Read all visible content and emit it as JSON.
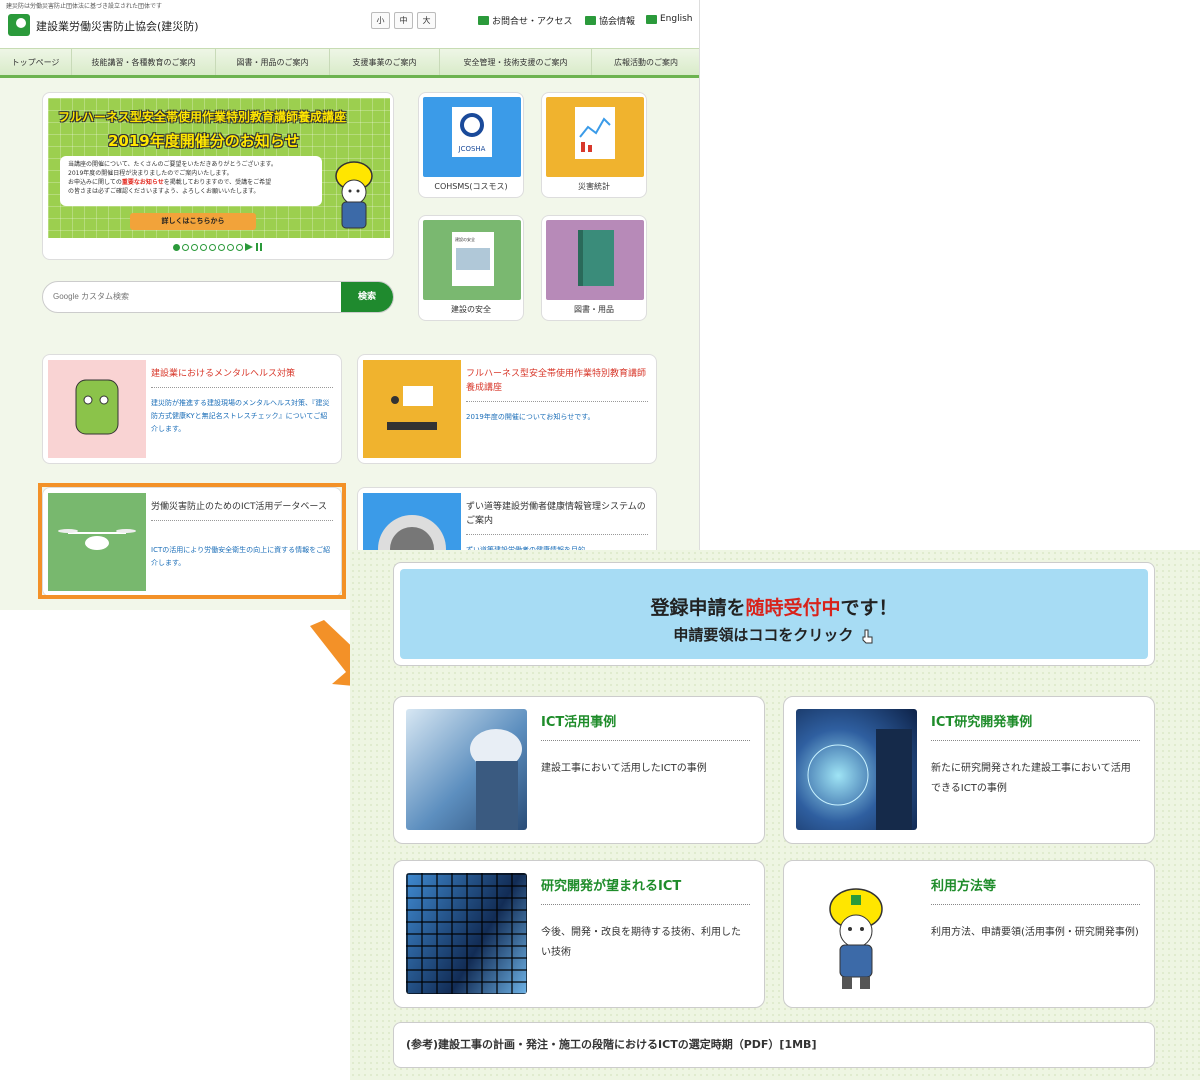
{
  "header": {
    "tagline": "建災防は労働災害防止団体法に基づき設立された団体です",
    "site_name": "建設業労働災害防止協会(建災防)",
    "font_sizes": [
      "小",
      "中",
      "大"
    ],
    "links": [
      {
        "label": "お問合せ・アクセス",
        "icon": "mail-icon"
      },
      {
        "label": "協会情報",
        "icon": "building-icon"
      },
      {
        "label": "English",
        "icon": "english-a-icon"
      }
    ]
  },
  "nav": [
    {
      "label": "トップページ"
    },
    {
      "label": "技能講習・各種教育のご案内"
    },
    {
      "label": "図書・用品のご案内"
    },
    {
      "label": "支援事業のご案内"
    },
    {
      "label": "安全管理・技術支援のご案内"
    },
    {
      "label": "広報活動のご案内"
    }
  ],
  "hero": {
    "line1": "フルハーネス型安全帯使用作業特別教育講師養成講座",
    "line2": "2019年度開催分のお知らせ",
    "body": [
      "当講座の開催について、たくさんのご要望をいただきありがとうございます。",
      "2019年度の開催日程が決まりましたのでご案内いたします。",
      "お申込みに関しての重要なお知らせを掲載しておりますので、受講をご希望",
      "の皆さまは必ずご確認くださいますよう、よろしくお願いいたします。"
    ],
    "body_highlight": "重要なお知らせ",
    "button": "詳しくはこちらから",
    "slide_count": 8,
    "active_slide": 1
  },
  "search": {
    "placeholder": "Google カスタム検索",
    "button": "検索"
  },
  "tiles": [
    {
      "label": "COHSMS(コスモス)",
      "icon": "cohsms-logo-icon",
      "color": "#3b9be8",
      "sublabel": "JCOSHA"
    },
    {
      "label": "災害統計",
      "icon": "chart-document-icon",
      "color": "#f0b32e"
    },
    {
      "label": "建設の安全",
      "icon": "magazine-icon",
      "color": "#7ab870",
      "sublabel": "建設の安全"
    },
    {
      "label": "図書・用品",
      "icon": "book-icon",
      "color": "#b78ab8"
    }
  ],
  "cards": [
    {
      "title": "建設業におけるメンタルヘルス対策",
      "desc": "建災防が推進する建設現場のメンタルヘルス対策、『建災防方式健康KYと無記名ストレスチェック』についてご紹介します。",
      "title_color": "#d8382b",
      "img": "mascot-icon",
      "img_color": "#f9d3d3"
    },
    {
      "title": "フルハーネス型安全帯使用作業特別教育講師養成講座",
      "desc": "2019年度の開催についてお知らせです。",
      "title_color": "#d8382b",
      "img": "lecture-icon",
      "img_color": "#f0b32e"
    },
    {
      "title": "労働災害防止のためのICT活用データベース",
      "desc": "ICTの活用により労働安全衛生の向上に資する情報をご紹介します。",
      "title_color": "#333333",
      "img": "drone-icon",
      "img_color": "#78b86e"
    },
    {
      "title": "ずい道等建設労働者健康情報管理システムのご案内",
      "desc": "ずい道等建設労働者の健康情報を目的",
      "title_color": "#333333",
      "img": "tunnel-icon",
      "img_color": "#3b9be8"
    }
  ],
  "ict": {
    "banner": {
      "part1": "登録申請を",
      "highlight": "随時受付中",
      "part2": "です！",
      "line2": "申請要領はココをクリック"
    },
    "cards": [
      {
        "title": "ICT活用事例",
        "desc": "建設工事において活用したICTの事例",
        "img": "ict-worker-photo"
      },
      {
        "title": "ICT研究開発事例",
        "desc": "新たに研究開発された建設工事において活用できるICTの事例",
        "img": "ict-research-photo"
      },
      {
        "title": "研究開発が望まれるICT",
        "desc": "今後、開発・改良を期待する技術、利用したい技術",
        "img": "monitor-wall-photo"
      },
      {
        "title": "利用方法等",
        "desc": "利用方法、申請要領(活用事例・研究開発事例)",
        "img": "mascot-helmet-icon"
      }
    ],
    "reference": "(参考)建設工事の計画・発注・施工の段階におけるICTの選定時期（PDF）[1MB]"
  },
  "colors": {
    "brand_green": "#2b9a3b",
    "highlight_orange": "#f39128",
    "ict_green": "#1e8c2a",
    "alert_red": "#d8231b"
  }
}
